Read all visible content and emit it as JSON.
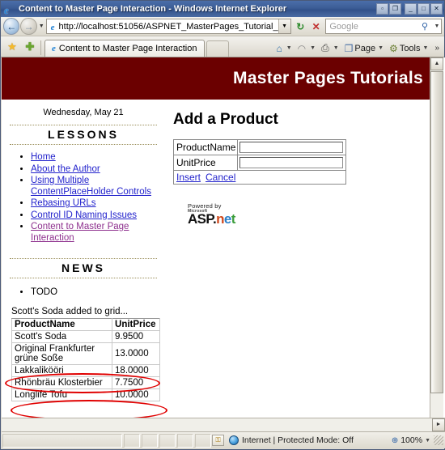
{
  "window": {
    "title": "Content to Master Page Interaction - Windows Internet Explorer",
    "buttons": {
      "restore_small": "▫",
      "extra": "❐",
      "minimize": "_",
      "maximize": "□",
      "close": "✕"
    }
  },
  "navbar": {
    "back": "←",
    "forward": "→",
    "history_caret": "▼",
    "address_value": "http://localhost:51056/ASPNET_MasterPages_Tutorial_",
    "address_dropdown": "▼",
    "refresh": "↻",
    "stop": "✕",
    "search_placeholder": "Google",
    "search_go": "⚲",
    "search_caret": "▼"
  },
  "tabbar": {
    "favorites": "★",
    "add_favorite": "✚",
    "tab_label": "Content to Master Page Interaction",
    "commands": [
      {
        "name": "home",
        "glyph": "⌂",
        "label": ""
      },
      {
        "name": "feeds",
        "glyph": "◠",
        "label": ""
      },
      {
        "name": "print",
        "glyph": "⎙",
        "label": ""
      },
      {
        "name": "page",
        "glyph": "❐",
        "label": "Page"
      },
      {
        "name": "tools",
        "glyph": "⚙",
        "label": "Tools"
      }
    ],
    "overflow": "»"
  },
  "page": {
    "banner_title": "Master Pages Tutorials",
    "sidebar": {
      "date": "Wednesday, May 21",
      "lessons_heading": "LESSONS",
      "lessons": [
        {
          "label": "Home",
          "visited": false
        },
        {
          "label": "About the Author",
          "visited": false
        },
        {
          "label": "Using Multiple ContentPlaceHolder Controls",
          "visited": false
        },
        {
          "label": "Rebasing URLs",
          "visited": false
        },
        {
          "label": "Control ID Naming Issues",
          "visited": false
        },
        {
          "label": "Content to Master Page Interaction",
          "visited": true
        }
      ],
      "news_heading": "NEWS",
      "news": [
        "TODO"
      ],
      "status_message": "Scott's Soda added to grid...",
      "grid": {
        "columns": [
          "ProductName",
          "UnitPrice"
        ],
        "rows": [
          {
            "ProductName": "Scott's Soda",
            "UnitPrice": "9.9500"
          },
          {
            "ProductName": "Original Frankfurter grüne Soße",
            "UnitPrice": "13.0000"
          },
          {
            "ProductName": "Lakkalikööri",
            "UnitPrice": "18.0000"
          },
          {
            "ProductName": "Rhönbräu Klosterbier",
            "UnitPrice": "7.7500"
          },
          {
            "ProductName": "Longlife Tofu",
            "UnitPrice": "10.0000"
          }
        ]
      }
    },
    "content": {
      "heading": "Add a Product",
      "fields": [
        {
          "label": "ProductName",
          "value": ""
        },
        {
          "label": "UnitPrice",
          "value": ""
        }
      ],
      "insert_label": "Insert",
      "cancel_label": "Cancel",
      "logo": {
        "powered_by": "Powered by",
        "microsoft": "Microsoft",
        "asp": "ASP",
        "dot": ".",
        "n": "n",
        "e": "e",
        "t": "t"
      }
    }
  },
  "scroll": {
    "up": "▲",
    "down": "▼",
    "right": "►"
  },
  "statusbar": {
    "zone_text": "Internet | Protected Mode: Off",
    "lock": "⚿",
    "zoom_icon": "⊕",
    "zoom_level": "100%",
    "zoom_caret": "▼"
  },
  "colors": {
    "banner": "#6b0000",
    "link": "#2222cc",
    "visited_link": "#8d2f8d",
    "annotation": "#e00000",
    "titlebar": "#3c5d96"
  }
}
